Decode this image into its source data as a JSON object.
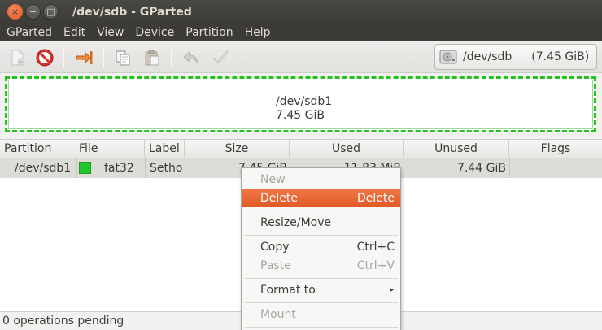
{
  "window": {
    "title": "/dev/sdb - GParted",
    "close_glyph": "×",
    "min_glyph": "−",
    "max_glyph": "□"
  },
  "menubar": {
    "items": [
      "GParted",
      "Edit",
      "View",
      "Device",
      "Partition",
      "Help"
    ]
  },
  "toolbar": {
    "buttons": [
      "new-partition-icon",
      "delete-icon",
      "resize-move-icon",
      "copy-icon",
      "paste-icon",
      "undo-icon",
      "apply-icon"
    ],
    "device": {
      "name": "/dev/sdb",
      "size": "(7.45 GiB)"
    }
  },
  "graphic": {
    "partition_name": "/dev/sdb1",
    "partition_size": "7.45 GiB",
    "fs_color": "#22c82b"
  },
  "table": {
    "headers": [
      "Partition",
      "File System",
      "Label",
      "Size",
      "Used",
      "Unused",
      "Flags"
    ],
    "rows": [
      {
        "partition": "/dev/sdb1",
        "filesystem": "fat32",
        "label": "Setho",
        "size": "7.45 GiB",
        "used": "11.83 MiB",
        "unused": "7.44 GiB",
        "flags": ""
      }
    ]
  },
  "context_menu": {
    "items": [
      {
        "label": "New",
        "accel": "",
        "state": "disabled"
      },
      {
        "label": "Delete",
        "accel": "Delete",
        "state": "active"
      },
      {
        "label": "Resize/Move",
        "accel": "",
        "state": "normal"
      },
      {
        "label": "Copy",
        "accel": "Ctrl+C",
        "state": "normal"
      },
      {
        "label": "Paste",
        "accel": "Ctrl+V",
        "state": "disabled"
      },
      {
        "label": "Format to",
        "accel": "▸",
        "state": "normal"
      },
      {
        "label": "Mount",
        "accel": "",
        "state": "disabled"
      }
    ]
  },
  "status": {
    "text": "0 operations pending"
  },
  "colors": {
    "accent": "#e05a25",
    "titlebar": "#3c3b37",
    "fat32": "#22c82b"
  }
}
